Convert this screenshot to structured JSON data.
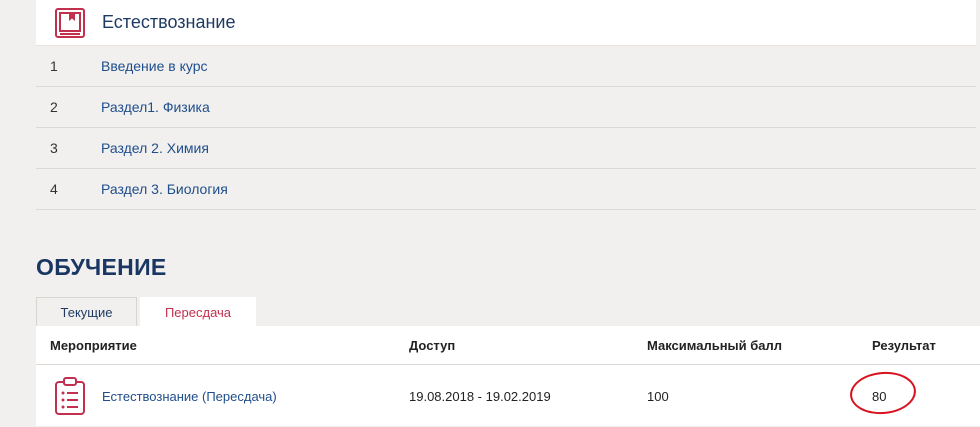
{
  "course": {
    "title": "Естествознание",
    "icon": "book-bookmark-icon",
    "sections": [
      {
        "num": "1",
        "label": "Введение в курс"
      },
      {
        "num": "2",
        "label": "Раздел1. Физика"
      },
      {
        "num": "3",
        "label": "Раздел 2. Химия"
      },
      {
        "num": "4",
        "label": "Раздел 3. Биология"
      }
    ]
  },
  "learning": {
    "heading": "ОБУЧЕНИЕ",
    "tabs": [
      {
        "label": "Текущие",
        "active": false
      },
      {
        "label": "Пересдача",
        "active": true
      }
    ],
    "table": {
      "headers": [
        "Мероприятие",
        "Доступ",
        "Максимальный балл",
        "Результат"
      ],
      "rows": [
        {
          "icon": "clipboard-list-icon",
          "event": "Естествознание (Пересдача)",
          "access": "19.08.2018 - 19.02.2019",
          "max_score": "100",
          "result": "80"
        }
      ]
    }
  },
  "colors": {
    "accent": "#c2304d",
    "heading": "#1a3663",
    "link": "#1f4e8c",
    "annotation": "#d8121e"
  }
}
